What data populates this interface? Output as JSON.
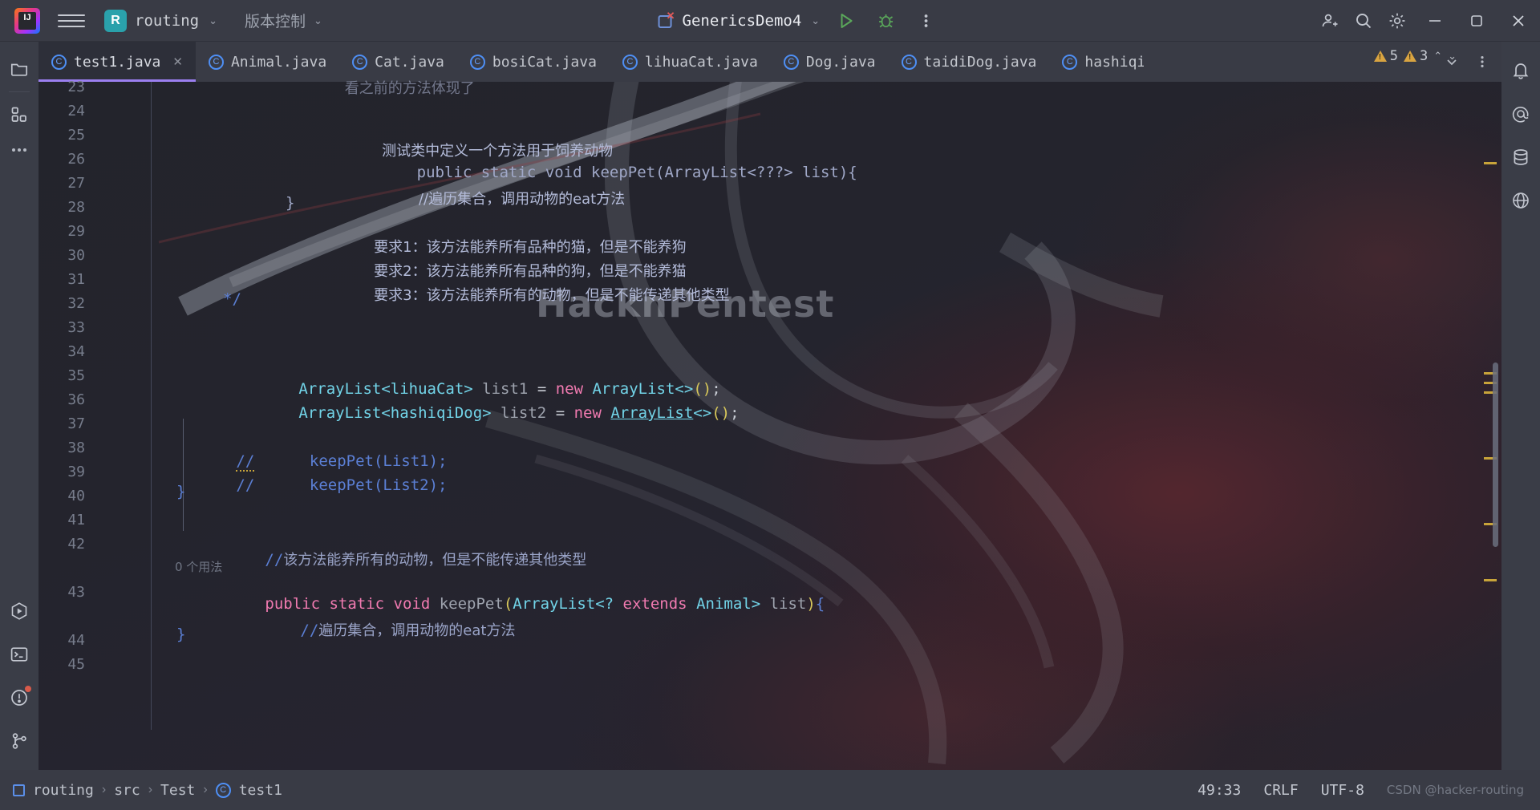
{
  "titlebar": {
    "menu_icon": "hamburger-icon",
    "project_badge": "R",
    "project_name": "routing",
    "vcs_label": "版本控制",
    "run_config": "GenericsDemo4",
    "run_icon": "run-icon",
    "debug_icon": "debug-icon",
    "more_icon": "more-vertical-icon",
    "account_icon": "account-icon",
    "search_icon": "search-icon",
    "settings_icon": "gear-icon",
    "minimize": "—",
    "maximize": "□",
    "close": "✕"
  },
  "left_toolbar": {
    "items": [
      {
        "name": "project-tool-window",
        "icon": "folder-icon"
      },
      {
        "name": "structure-tool-window",
        "icon": "modules-icon"
      },
      {
        "name": "more-tool-windows",
        "icon": "ellipsis-icon"
      },
      {
        "name": "run-tool-window",
        "icon": "run-hex-icon"
      },
      {
        "name": "terminal-tool-window",
        "icon": "terminal-icon"
      },
      {
        "name": "problems-tool-window",
        "icon": "problems-icon"
      },
      {
        "name": "version-control-tool-window",
        "icon": "branch-icon"
      }
    ]
  },
  "right_toolbar": {
    "items": [
      {
        "name": "notifications",
        "icon": "bell-icon"
      },
      {
        "name": "ai-assistant",
        "icon": "at-icon"
      },
      {
        "name": "database",
        "icon": "database-icon"
      },
      {
        "name": "web-preview",
        "icon": "globe-icon"
      }
    ]
  },
  "tabs": {
    "items": [
      {
        "label": "test1.java",
        "icon": "java-class-icon",
        "active": true,
        "closable": true
      },
      {
        "label": "Animal.java",
        "icon": "java-class-icon",
        "active": false,
        "closable": false
      },
      {
        "label": "Cat.java",
        "icon": "java-class-icon",
        "active": false,
        "closable": false
      },
      {
        "label": "bosiCat.java",
        "icon": "java-class-icon",
        "active": false,
        "closable": false
      },
      {
        "label": "lihuaCat.java",
        "icon": "java-class-icon",
        "active": false,
        "closable": false
      },
      {
        "label": "Dog.java",
        "icon": "java-class-icon",
        "active": false,
        "closable": false
      },
      {
        "label": "taidiDog.java",
        "icon": "java-class-icon",
        "active": false,
        "closable": false
      },
      {
        "label": "hashiqi",
        "icon": "java-class-icon",
        "active": false,
        "closable": false
      }
    ],
    "overflow_icon": "chevron-down-icon",
    "options_icon": "more-vertical-icon"
  },
  "inspection": {
    "warnings_count": "5",
    "weak_warnings_count": "3",
    "up_icon": "chevron-up-icon",
    "down_icon": "chevron-down-icon"
  },
  "editor": {
    "watermark": "HacknPentest",
    "first_visible_line": 23,
    "lines": [
      {
        "n": 23,
        "text": "        看之前的方法体现了",
        "partial": true
      },
      {
        "n": 24,
        "text": ""
      },
      {
        "n": 25,
        "text": "        测试类中定义一个方法用于饲养动物"
      },
      {
        "n": 26,
        "text": "            public static void keepPet(ArrayList<???> list){"
      },
      {
        "n": 27,
        "text": "                //遍历集合，调用动物的eat方法"
      },
      {
        "n": 28,
        "text": "            }"
      },
      {
        "n": 29,
        "text": "        要求1：该方法能养所有品种的猫，但是不能养狗"
      },
      {
        "n": 30,
        "text": "        要求2：该方法能养所有品种的狗，但是不能养猫"
      },
      {
        "n": 31,
        "text": "        要求3：该方法能养所有的动物，但是不能传递其他类型"
      },
      {
        "n": 32,
        "text": "     */"
      },
      {
        "n": 33,
        "text": ""
      },
      {
        "n": 34,
        "text": ""
      },
      {
        "n": 35,
        "text": "    ArrayList<lihuaCat> list1 = new ArrayList<>();"
      },
      {
        "n": 36,
        "text": "    ArrayList<hashiqiDog> list2 = new ArrayList<>();"
      },
      {
        "n": 37,
        "text": ""
      },
      {
        "n": 38,
        "text": "//      keepPet(List1);",
        "commented": true
      },
      {
        "n": 39,
        "text": "//      keepPet(List2);",
        "commented": true
      },
      {
        "n": 40,
        "text": "  }"
      },
      {
        "n": 41,
        "text": ""
      },
      {
        "n": 42,
        "text": "  //该方法能养所有的动物，但是不能传递其他类型"
      },
      {
        "n": 43,
        "text": "  public static void keepPet(ArrayList<? extends Animal> list){"
      },
      {
        "n": 44,
        "text": "      //遍历集合，调用动物的eat方法"
      },
      {
        "n": 45,
        "text": "  }"
      }
    ],
    "code_vision_hint": "0 个用法"
  },
  "statusbar": {
    "breadcrumb": [
      {
        "label": "routing",
        "icon": "module-icon"
      },
      {
        "label": "src",
        "icon": null
      },
      {
        "label": "Test",
        "icon": null
      },
      {
        "label": "test1",
        "icon": "java-class-icon"
      }
    ],
    "separator": "›",
    "caret_position": "49:33",
    "line_separator": "CRLF",
    "encoding": "UTF-8",
    "watermark": "CSDN @hacker-routing"
  },
  "colors": {
    "accent_purple": "#9b7ff0",
    "toolbar_bg": "#3a3d47",
    "titlebar_bg": "#393b45",
    "editor_bg": "#262430",
    "tab_active_bg": "#2d2f39",
    "keyword": "#f07ab0",
    "type": "#72d4e8",
    "comment": "#a0a8c8",
    "warning": "#d9a441",
    "run_green": "#5aa75a",
    "project_badge": "#2aa1ab"
  }
}
